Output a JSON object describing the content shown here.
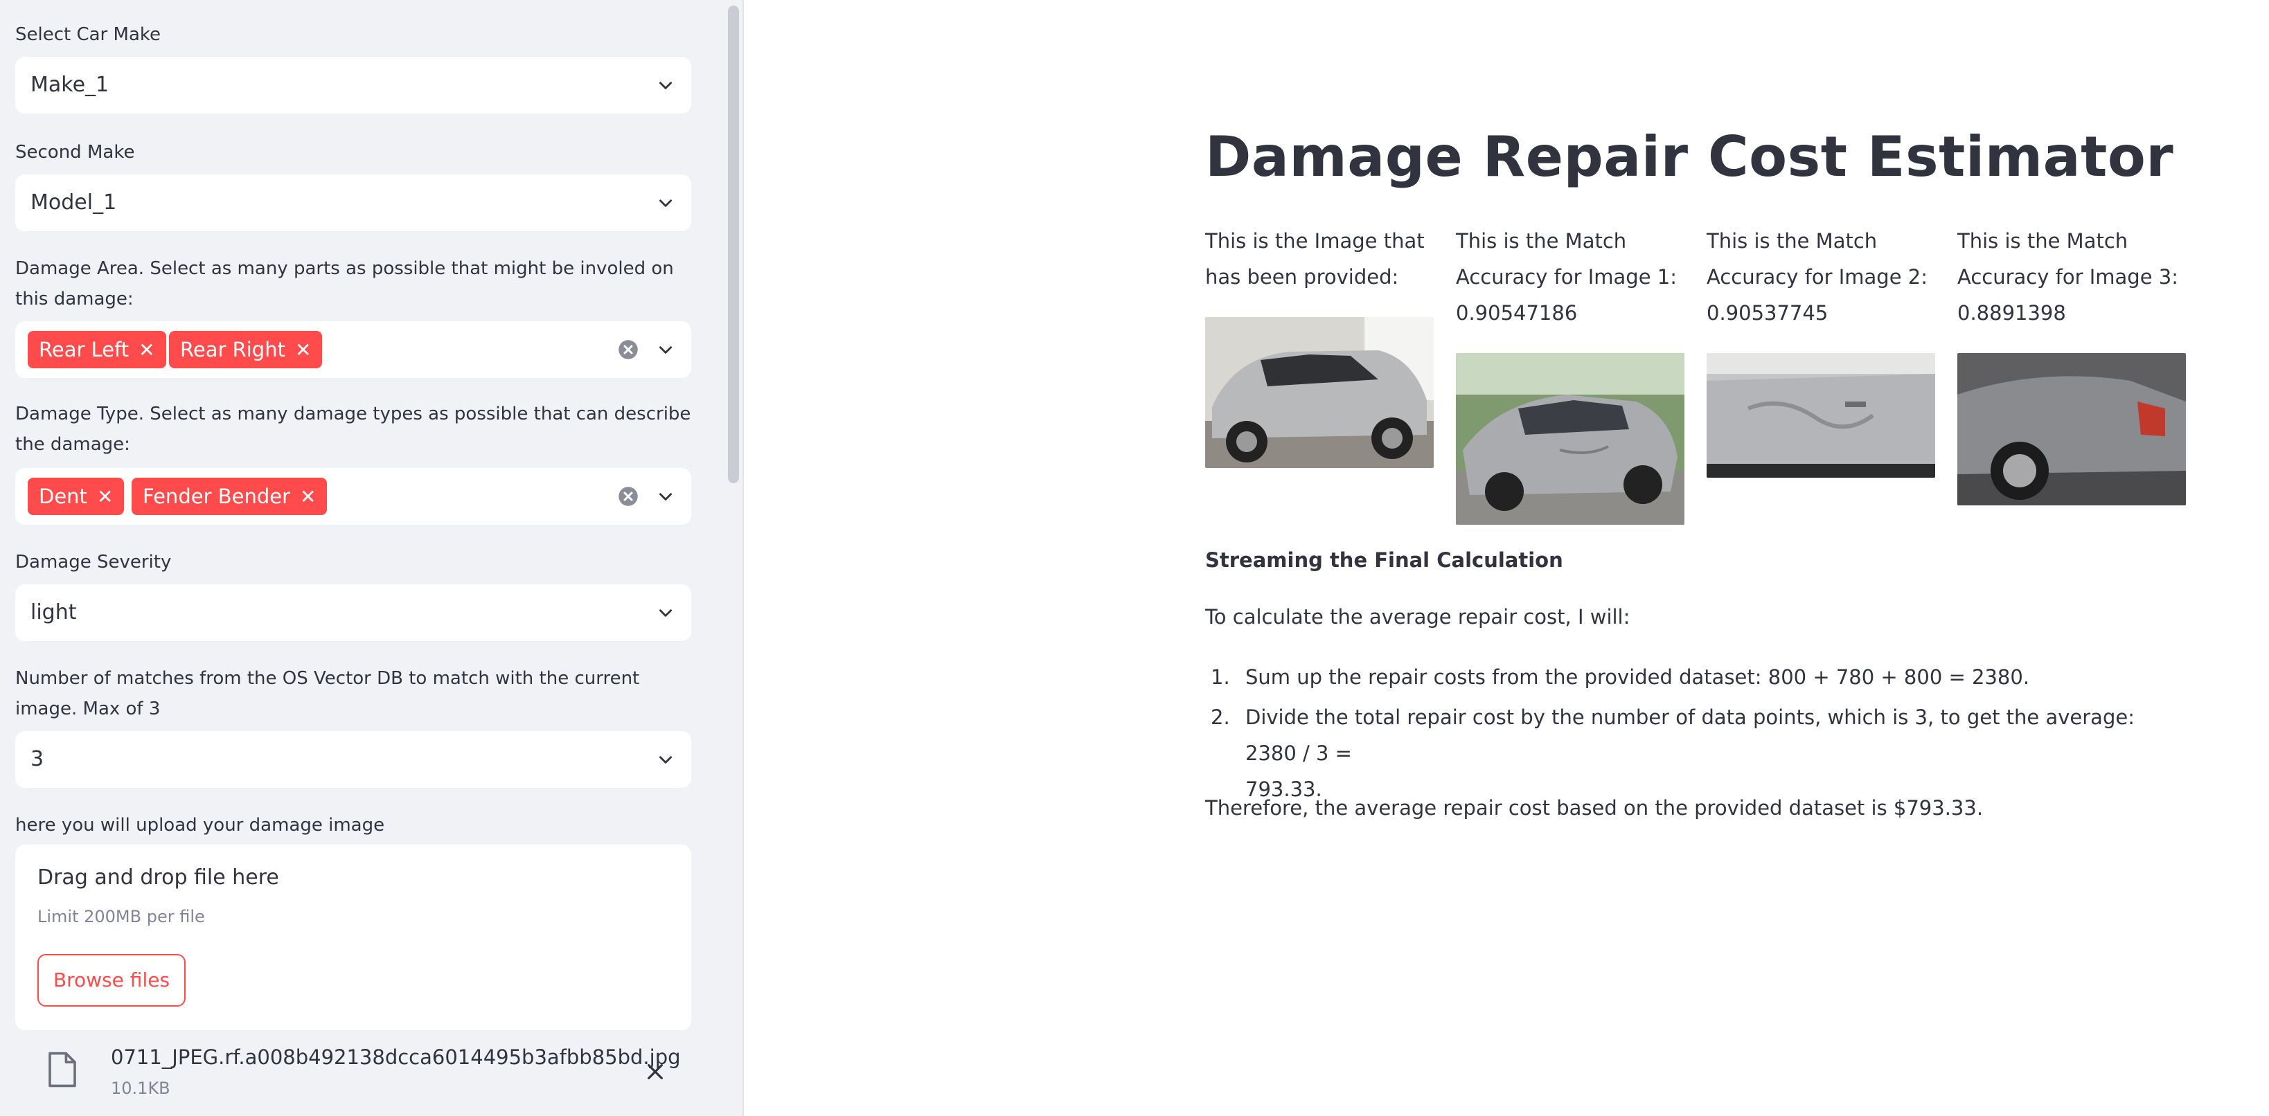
{
  "sidebar": {
    "make": {
      "label": "Select Car Make",
      "value": "Make_1"
    },
    "model": {
      "label": "Second Make",
      "value": "Model_1"
    },
    "damage_area": {
      "label": "Damage Area. Select as many parts as possible that might be involed on this damage:",
      "tags": [
        "Rear Left",
        "Rear Right"
      ]
    },
    "damage_type": {
      "label": "Damage Type. Select as many damage types as possible that can describe the damage:",
      "tags": [
        "Dent",
        "Fender Bender"
      ]
    },
    "severity": {
      "label": "Damage Severity",
      "value": "light"
    },
    "matches": {
      "label": "Number of matches from the OS Vector DB to match with the current image. Max of 3",
      "value": "3"
    },
    "uploader": {
      "label": "here you will upload your damage image",
      "drop_title": "Drag and drop file here",
      "limit": "Limit 200MB per file",
      "browse_label": "Browse files",
      "file_name": "0711_JPEG.rf.a008b492138dcca6014495b3afbb85bd.jpg",
      "file_size": "10.1KB"
    }
  },
  "main": {
    "title": "Damage Repair Cost Estimator",
    "columns": [
      {
        "caption_lines": [
          "This is the Image that",
          "has been provided:"
        ]
      },
      {
        "caption_lines": [
          "This is the Match",
          "Accuracy for Image 1:",
          "0.90547186"
        ]
      },
      {
        "caption_lines": [
          "This is the Match",
          "Accuracy for Image 2:",
          "0.90537745"
        ]
      },
      {
        "caption_lines": [
          "This is the Match",
          "Accuracy for Image 3:",
          "0.8891398"
        ]
      }
    ],
    "stream_title": "Streaming the Final Calculation",
    "intro": "To calculate the average repair cost, I will:",
    "steps": [
      {
        "num": "1.",
        "text": "Sum up the repair costs from the provided dataset: 800 + 780 + 800 = 2380."
      },
      {
        "num": "2.",
        "text_lines": [
          "Divide the total repair cost by the number of data points, which is 3, to get the average: 2380 / 3 =",
          "793.33."
        ]
      }
    ],
    "conclusion": "Therefore, the average repair cost based on the provided dataset is $793.33."
  },
  "colors": {
    "accent": "#ff4b4b",
    "sidebar_bg": "#f0f2f6",
    "text": "#31333f",
    "muted": "#808495"
  },
  "icons": [
    "chevron-down-icon",
    "clear-icon",
    "close-icon",
    "file-icon"
  ]
}
